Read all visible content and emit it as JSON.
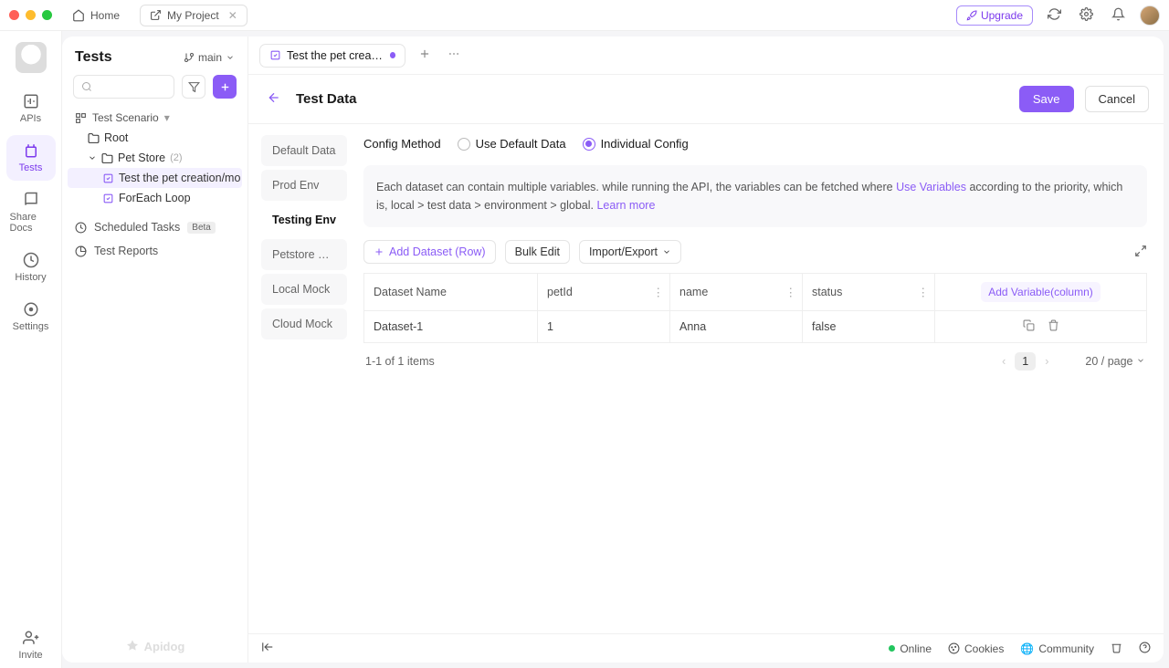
{
  "titlebar": {
    "home": "Home",
    "project": "My Project",
    "upgrade": "Upgrade"
  },
  "rail": {
    "items": [
      "APIs",
      "Tests",
      "Share Docs",
      "History",
      "Settings"
    ],
    "invite": "Invite"
  },
  "sidebar": {
    "title": "Tests",
    "branch": "main",
    "section": "Test Scenario",
    "tree": {
      "root": "Root",
      "folder": "Pet Store",
      "folder_count": "(2)",
      "item1": "Test the pet creation/mo",
      "item2": "ForEach Loop"
    },
    "scheduled": "Scheduled Tasks",
    "scheduled_badge": "Beta",
    "reports": "Test Reports",
    "logo": "Apidog"
  },
  "tabs": {
    "tab1": "Test the pet creation/"
  },
  "page": {
    "title": "Test Data",
    "save": "Save",
    "cancel": "Cancel"
  },
  "envs": [
    "Default Data",
    "Prod Env",
    "Testing Env",
    "Petstore Env",
    "Local Mock",
    "Cloud Mock"
  ],
  "config": {
    "label": "Config Method",
    "opt1": "Use Default Data",
    "opt2": "Individual Config"
  },
  "info": {
    "text1": "Each dataset can contain multiple variables. while running the API, the variables can be fetched where ",
    "link1": "Use Variables",
    "text2": " according to the priority, which is, local > test data > environment > global. ",
    "link2": "Learn more"
  },
  "toolbar": {
    "add_row": "Add Dataset (Row)",
    "bulk": "Bulk Edit",
    "import": "Import/Export"
  },
  "table": {
    "headers": [
      "Dataset Name",
      "petId",
      "name",
      "status"
    ],
    "addvar": "Add Variable(column)",
    "row": {
      "name": "Dataset-1",
      "petId": "1",
      "person": "Anna",
      "status": "false"
    }
  },
  "pager": {
    "summary": "1-1 of 1 items",
    "page": "1",
    "perpage": "20 / page"
  },
  "statusbar": {
    "online": "Online",
    "cookies": "Cookies",
    "community": "Community"
  }
}
